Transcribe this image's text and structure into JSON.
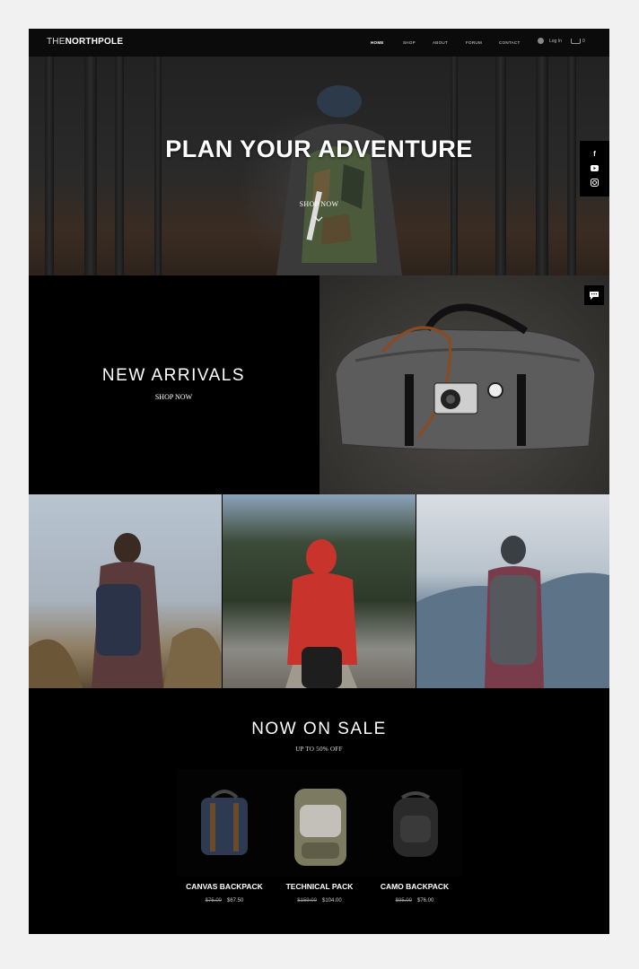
{
  "brand": {
    "prefix": "THE",
    "name": "NORTHPOLE"
  },
  "nav": [
    {
      "label": "HOME"
    },
    {
      "label": "SHOP"
    },
    {
      "label": "ABOUT"
    },
    {
      "label": "FORUM"
    },
    {
      "label": "CONTACT"
    }
  ],
  "account": {
    "login_label": "Log In",
    "cart_count": "0"
  },
  "hero": {
    "title": "PLAN YOUR ADVENTURE",
    "cta": "SHOP NOW"
  },
  "social": [
    "facebook-icon",
    "youtube-icon",
    "instagram-icon"
  ],
  "arrivals": {
    "title": "NEW ARRIVALS",
    "cta": "SHOP NOW"
  },
  "sale": {
    "title": "NOW ON SALE",
    "subtitle": "UP TO 50% OFF",
    "products": [
      {
        "name": "CANVAS BACKPACK",
        "old_price": "$75.00",
        "price": "$67.50"
      },
      {
        "name": "TECHNICAL PACK",
        "old_price": "$159.00",
        "price": "$104.00"
      },
      {
        "name": "CAMO BACKPACK",
        "old_price": "$95.00",
        "price": "$76.00"
      }
    ]
  },
  "colors": {
    "background": "#000000",
    "page_bg": "#f1f1f1",
    "text": "#ffffff"
  }
}
